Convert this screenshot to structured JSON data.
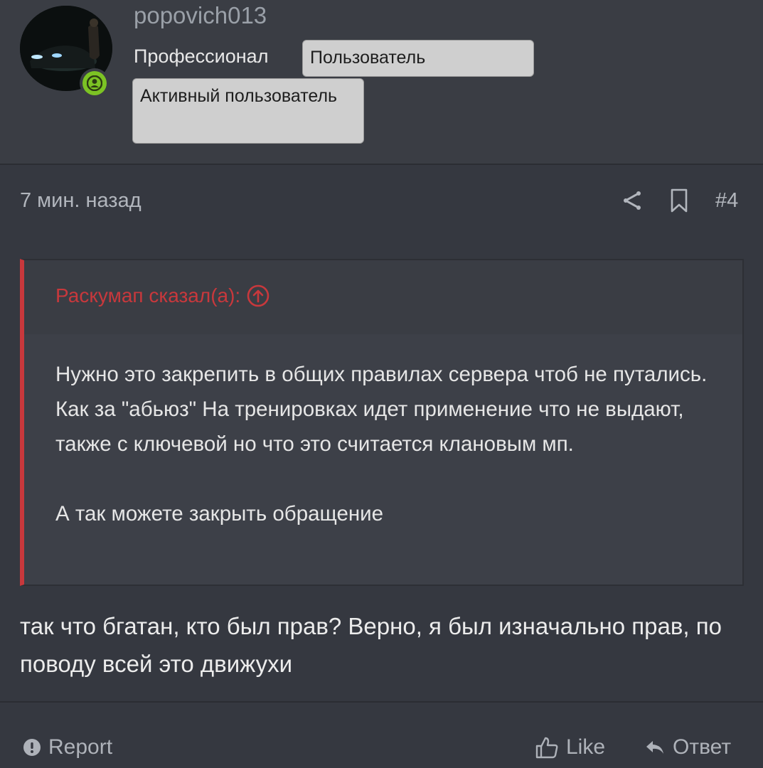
{
  "user": {
    "username": "popovich013",
    "rank": "Профессионал",
    "badges": [
      "Пользователь",
      "Активный пользователь"
    ],
    "online": true
  },
  "post": {
    "timestamp": "7 мин. назад",
    "post_number": "#4",
    "quote": {
      "author_line": "Раскумап сказал(а):",
      "paragraph_1": "Нужно это закрепить в общих правилах сервера чтоб не путались. Как за \"абьюз\" На тренировках идет применение что не выдают, также с ключевой но что это считается клановым мп.",
      "paragraph_2": "А так можете закрыть обращение"
    },
    "body": "так что бгатан, кто был прав? Верно, я был изначально прав, по поводу всей это движухи"
  },
  "actions": {
    "report_label": "Report",
    "like_label": "Like",
    "reply_label": "Ответ"
  },
  "icons": {
    "online": "user-online-icon",
    "share": "share-icon",
    "bookmark": "bookmark-icon",
    "quote_jump": "arrow-up-circle-icon",
    "report": "alert-circle-icon",
    "like": "thumbs-up-icon",
    "reply": "reply-arrow-icon"
  },
  "colors": {
    "background": "#353840",
    "quote_accent": "#c8383c",
    "online_green": "#7cc324",
    "badge_bg": "#cfcfcf"
  }
}
